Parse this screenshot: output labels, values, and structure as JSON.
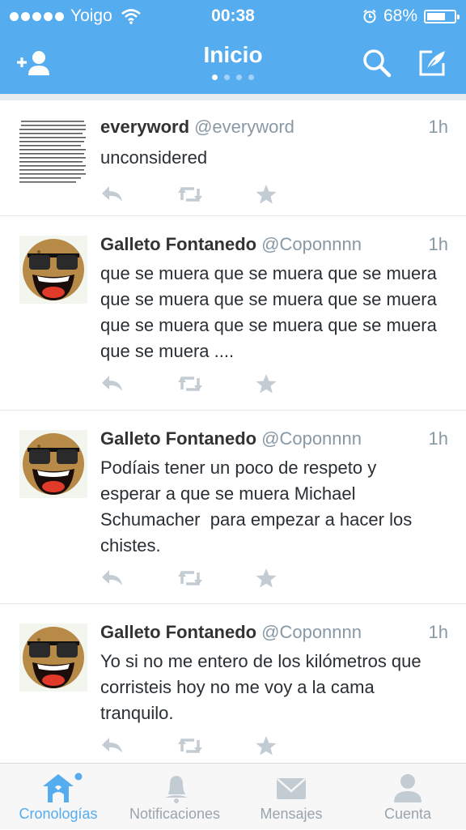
{
  "status_bar": {
    "carrier": "Yoigo",
    "time": "00:38",
    "battery_percent": "68%",
    "battery_level": 0.68
  },
  "nav": {
    "title": "Inicio",
    "page_count": 4,
    "active_page": 0
  },
  "tweets": [
    {
      "name": "everyword",
      "handle": "@everyword",
      "time": "1h",
      "text": "unconsidered",
      "avatar": "word-list-avatar"
    },
    {
      "name": "Galleto Fontanedo",
      "handle": "@Coponnnn",
      "time": "1h",
      "text": "que se muera que se muera que se muera que se muera que se muera que se muera que se muera que se muera que se muera que se muera ....",
      "avatar": "cookie-avatar"
    },
    {
      "name": "Galleto Fontanedo",
      "handle": "@Coponnnn",
      "time": "1h",
      "text": "Podíais tener un poco de respeto y esperar a que se muera Michael Schumacher  para empezar a hacer los chistes.",
      "avatar": "cookie-avatar"
    },
    {
      "name": "Galleto Fontanedo",
      "handle": "@Coponnnn",
      "time": "1h",
      "text": "Yo si no me entero de los kilómetros que corristeis hoy no me voy a la cama tranquilo.",
      "avatar": "cookie-avatar"
    }
  ],
  "tabs": [
    {
      "label": "Cronologías",
      "icon": "home-icon",
      "active": true
    },
    {
      "label": "Notificaciones",
      "icon": "bell-icon",
      "active": false
    },
    {
      "label": "Mensajes",
      "icon": "envelope-icon",
      "active": false
    },
    {
      "label": "Cuenta",
      "icon": "person-icon",
      "active": false
    }
  ],
  "colors": {
    "accent": "#55acee",
    "icon_gray": "#c4ccd3",
    "text": "#292f33",
    "muted": "#8899a6"
  }
}
